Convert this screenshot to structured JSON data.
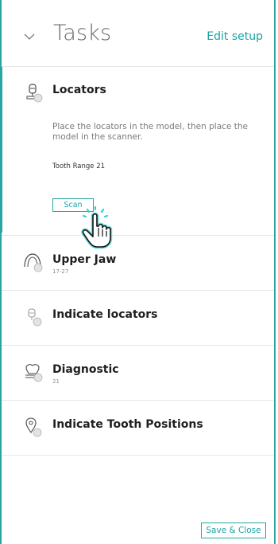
{
  "header": {
    "title": "Tasks",
    "edit_setup": "Edit setup"
  },
  "tasks": [
    {
      "title": "Locators",
      "description": "Place the locators in the model, then place the model in the scanner.",
      "range_label": "Tooth Range 21",
      "scan_label": "Scan",
      "icon": "locator-icon"
    },
    {
      "title": "Upper Jaw",
      "subtitle": "17-27",
      "icon": "upper-jaw-icon"
    },
    {
      "title": "Indicate locators",
      "icon": "locator-outline-icon"
    },
    {
      "title": "Diagnostic",
      "subtitle": "21",
      "icon": "tooth-icon"
    },
    {
      "title": "Indicate Tooth Positions",
      "icon": "tooth-position-icon"
    }
  ],
  "footer": {
    "save_close": "Save & Close"
  },
  "colors": {
    "accent": "#2aa5a3",
    "link": "#1ca3a6"
  }
}
